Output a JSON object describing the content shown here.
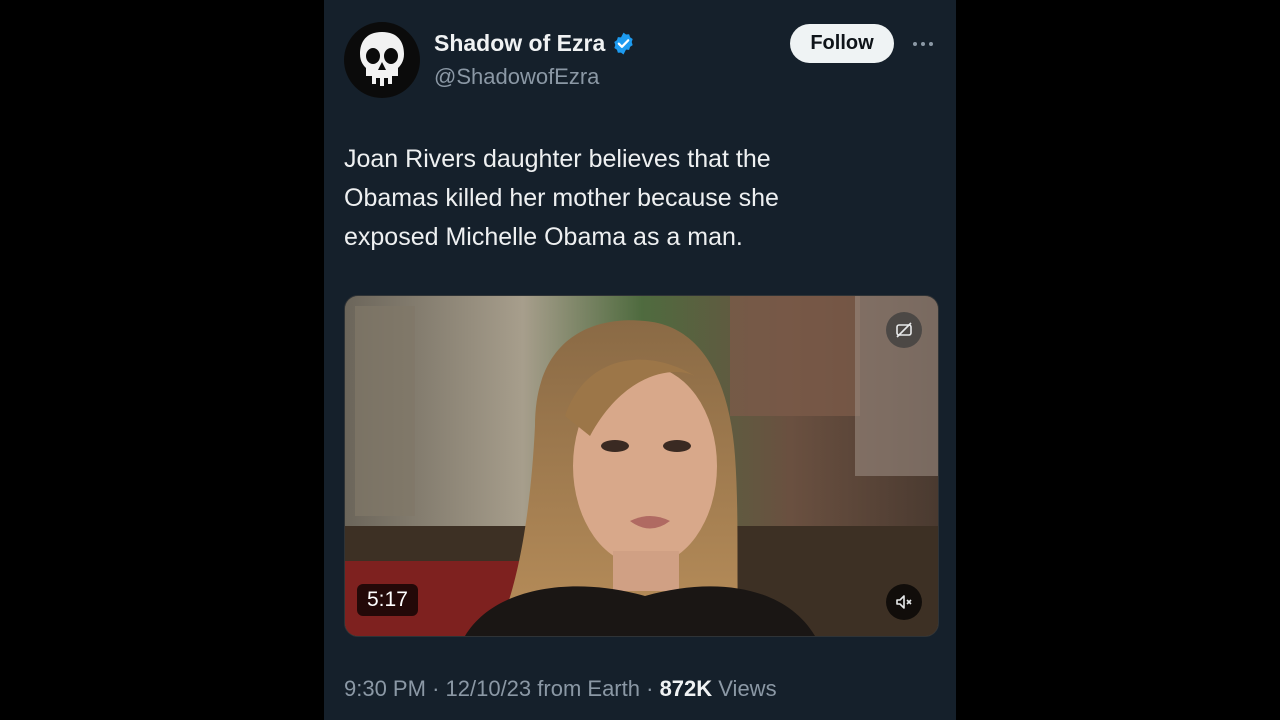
{
  "author": {
    "display_name": "Shadow of Ezra",
    "handle": "@ShadowofEzra",
    "verified": true
  },
  "follow_label": "Follow",
  "tweet": {
    "lines": [
      "Joan Rivers daughter believes that the",
      "Obamas killed her mother because she",
      "exposed Michelle Obama as a man."
    ]
  },
  "video": {
    "duration": "5:17",
    "muted": true
  },
  "meta": {
    "time": "9:30 PM",
    "date": "12/10/23",
    "source": "from Earth",
    "views_count": "872K",
    "views_label": "Views",
    "separator": "·"
  },
  "colors": {
    "background": "#15202b",
    "verified_blue": "#1d9bf0",
    "secondary_text": "#8b98a5"
  },
  "icons": [
    "skull-avatar-icon",
    "verified-badge-icon",
    "more-options-icon",
    "captions-off-icon",
    "mute-icon"
  ]
}
